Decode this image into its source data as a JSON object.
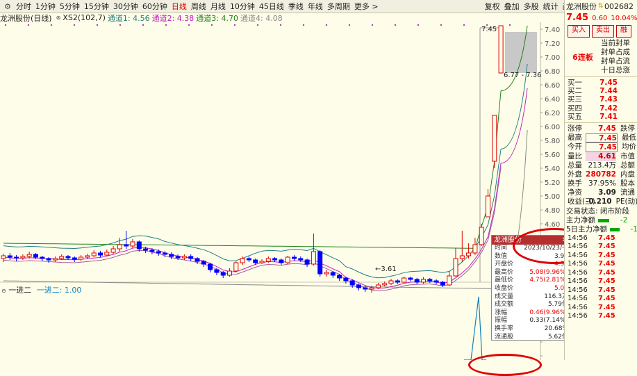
{
  "toolbar": {
    "items": [
      "分时",
      "1分钟",
      "5分钟",
      "15分钟",
      "30分钟",
      "60分钟",
      "日线",
      "周线",
      "月线",
      "10分钟",
      "45日线",
      "季线",
      "年线",
      "多周期",
      "更多 >"
    ],
    "active_index": 6,
    "right_items": [
      "复权",
      "叠加",
      "多股",
      "统计",
      "画线",
      "F10",
      "标记",
      "返回"
    ]
  },
  "legend": {
    "title": "龙洲股份(日线)",
    "xs2": "XS2(102,7)",
    "channel1": "通道1: 4.56",
    "channel2": "通道2: 4.38",
    "channel3": "通道3: 4.70",
    "channel4": "通道4: 4.08",
    "colors": {
      "ch1": "#208080",
      "ch2": "#c020c0",
      "ch3": "#208020",
      "ch4": "#888888"
    }
  },
  "sub_legend": {
    "name": "一进二",
    "value_label": "一进二: 1.00"
  },
  "chart_data": {
    "type": "candlestick",
    "title": "龙洲股份(日线)",
    "y_ticks": [
      "7.40",
      "7.20",
      "7.00",
      "6.80",
      "6.60",
      "6.40",
      "6.20",
      "6.00",
      "5.80",
      "5.60",
      "5.40",
      "5.20",
      "5.00",
      "4.80",
      "4.60",
      "4.40",
      "4.20",
      "4.00",
      "3.80",
      "3.60",
      "3.40",
      "3.20"
    ],
    "ylim": [
      3.2,
      7.45
    ],
    "annotations": {
      "high": "7.45",
      "low": "3.61",
      "band": "6.77 - 7.36"
    },
    "candles": [
      {
        "o": 4.1,
        "c": 4.14,
        "h": 4.17,
        "l": 4.05
      },
      {
        "o": 4.14,
        "c": 4.12,
        "h": 4.18,
        "l": 4.08
      },
      {
        "o": 4.12,
        "c": 4.11,
        "h": 4.15,
        "l": 4.06
      },
      {
        "o": 4.11,
        "c": 4.13,
        "h": 4.16,
        "l": 4.08
      },
      {
        "o": 4.13,
        "c": 4.16,
        "h": 4.2,
        "l": 4.1
      },
      {
        "o": 4.16,
        "c": 4.12,
        "h": 4.18,
        "l": 4.09
      },
      {
        "o": 4.12,
        "c": 4.1,
        "h": 4.14,
        "l": 4.06
      },
      {
        "o": 4.1,
        "c": 4.08,
        "h": 4.12,
        "l": 4.04
      },
      {
        "o": 4.08,
        "c": 4.1,
        "h": 4.13,
        "l": 4.05
      },
      {
        "o": 4.1,
        "c": 4.13,
        "h": 4.16,
        "l": 4.08
      },
      {
        "o": 4.13,
        "c": 4.11,
        "h": 4.15,
        "l": 4.08
      },
      {
        "o": 4.11,
        "c": 4.09,
        "h": 4.13,
        "l": 4.05
      },
      {
        "o": 4.09,
        "c": 4.12,
        "h": 4.15,
        "l": 4.06
      },
      {
        "o": 4.12,
        "c": 4.14,
        "h": 4.17,
        "l": 4.09
      },
      {
        "o": 4.14,
        "c": 4.18,
        "h": 4.22,
        "l": 4.12
      },
      {
        "o": 4.18,
        "c": 4.15,
        "h": 4.21,
        "l": 4.12
      },
      {
        "o": 4.15,
        "c": 4.19,
        "h": 4.23,
        "l": 4.13
      },
      {
        "o": 4.19,
        "c": 4.24,
        "h": 4.28,
        "l": 4.16
      },
      {
        "o": 4.24,
        "c": 4.3,
        "h": 4.4,
        "l": 4.2
      },
      {
        "o": 4.3,
        "c": 4.28,
        "h": 4.5,
        "l": 4.24
      },
      {
        "o": 4.28,
        "c": 4.34,
        "h": 4.38,
        "l": 4.25
      },
      {
        "o": 4.34,
        "c": 4.24,
        "h": 4.36,
        "l": 4.2
      },
      {
        "o": 4.24,
        "c": 4.22,
        "h": 4.27,
        "l": 4.18
      },
      {
        "o": 4.22,
        "c": 4.2,
        "h": 4.25,
        "l": 4.16
      },
      {
        "o": 4.2,
        "c": 4.18,
        "h": 4.23,
        "l": 4.14
      },
      {
        "o": 4.18,
        "c": 4.16,
        "h": 4.21,
        "l": 4.12
      },
      {
        "o": 4.16,
        "c": 4.13,
        "h": 4.19,
        "l": 4.09
      },
      {
        "o": 4.13,
        "c": 4.11,
        "h": 4.16,
        "l": 4.08
      },
      {
        "o": 4.11,
        "c": 4.13,
        "h": 4.16,
        "l": 4.08
      },
      {
        "o": 4.13,
        "c": 4.1,
        "h": 4.16,
        "l": 4.06
      },
      {
        "o": 4.1,
        "c": 4.06,
        "h": 4.12,
        "l": 4.02
      },
      {
        "o": 4.06,
        "c": 4.02,
        "h": 4.08,
        "l": 3.98
      },
      {
        "o": 4.02,
        "c": 3.94,
        "h": 4.04,
        "l": 3.9
      },
      {
        "o": 3.94,
        "c": 3.9,
        "h": 3.96,
        "l": 3.86
      },
      {
        "o": 3.9,
        "c": 3.86,
        "h": 3.92,
        "l": 3.82
      },
      {
        "o": 3.86,
        "c": 3.92,
        "h": 3.96,
        "l": 3.84
      },
      {
        "o": 3.92,
        "c": 4.04,
        "h": 4.06,
        "l": 3.9
      },
      {
        "o": 4.04,
        "c": 4.1,
        "h": 4.13,
        "l": 4.01
      },
      {
        "o": 4.1,
        "c": 4.08,
        "h": 4.13,
        "l": 4.05
      },
      {
        "o": 4.08,
        "c": 4.04,
        "h": 4.1,
        "l": 4.01
      },
      {
        "o": 4.04,
        "c": 4.06,
        "h": 4.09,
        "l": 4.02
      },
      {
        "o": 4.06,
        "c": 4.1,
        "h": 4.13,
        "l": 4.04
      },
      {
        "o": 4.1,
        "c": 4.08,
        "h": 4.12,
        "l": 4.05
      },
      {
        "o": 4.08,
        "c": 4.04,
        "h": 4.1,
        "l": 4.01
      },
      {
        "o": 4.04,
        "c": 4.12,
        "h": 4.14,
        "l": 4.02
      },
      {
        "o": 4.12,
        "c": 4.1,
        "h": 4.15,
        "l": 4.07
      },
      {
        "o": 4.1,
        "c": 4.08,
        "h": 4.13,
        "l": 4.05
      },
      {
        "o": 4.08,
        "c": 4.02,
        "h": 4.1,
        "l": 3.98
      },
      {
        "o": 4.02,
        "c": 4.2,
        "h": 4.46,
        "l": 4.0
      },
      {
        "o": 4.2,
        "c": 3.88,
        "h": 4.22,
        "l": 3.84
      },
      {
        "o": 3.88,
        "c": 3.9,
        "h": 3.94,
        "l": 3.84
      },
      {
        "o": 3.9,
        "c": 3.86,
        "h": 3.92,
        "l": 3.82
      },
      {
        "o": 3.86,
        "c": 3.82,
        "h": 3.88,
        "l": 3.78
      },
      {
        "o": 3.82,
        "c": 3.78,
        "h": 3.84,
        "l": 3.74
      },
      {
        "o": 3.78,
        "c": 3.72,
        "h": 3.8,
        "l": 3.68
      },
      {
        "o": 3.72,
        "c": 3.68,
        "h": 3.74,
        "l": 3.64
      },
      {
        "o": 3.68,
        "c": 3.66,
        "h": 3.71,
        "l": 3.62
      },
      {
        "o": 3.66,
        "c": 3.68,
        "h": 3.71,
        "l": 3.61
      },
      {
        "o": 3.68,
        "c": 3.72,
        "h": 3.75,
        "l": 3.66
      },
      {
        "o": 3.72,
        "c": 3.74,
        "h": 3.77,
        "l": 3.7
      },
      {
        "o": 3.74,
        "c": 3.78,
        "h": 3.81,
        "l": 3.72
      },
      {
        "o": 3.78,
        "c": 3.76,
        "h": 3.8,
        "l": 3.73
      },
      {
        "o": 3.76,
        "c": 3.82,
        "h": 3.84,
        "l": 3.74
      },
      {
        "o": 3.82,
        "c": 3.8,
        "h": 3.84,
        "l": 3.77
      },
      {
        "o": 3.8,
        "c": 3.76,
        "h": 3.82,
        "l": 3.73
      },
      {
        "o": 3.76,
        "c": 3.8,
        "h": 3.83,
        "l": 3.74
      },
      {
        "o": 3.8,
        "c": 3.78,
        "h": 3.82,
        "l": 3.75
      },
      {
        "o": 3.78,
        "c": 3.76,
        "h": 3.8,
        "l": 3.73
      },
      {
        "o": 3.76,
        "c": 3.72,
        "h": 3.78,
        "l": 3.69
      },
      {
        "o": 3.72,
        "c": 3.85,
        "h": 3.92,
        "l": 3.7
      },
      {
        "o": 3.85,
        "c": 4.1,
        "h": 4.25,
        "l": 3.84
      },
      {
        "o": 4.1,
        "c": 4.14,
        "h": 4.5,
        "l": 4.05
      },
      {
        "o": 4.14,
        "c": 4.18,
        "h": 4.32,
        "l": 4.1
      },
      {
        "o": 4.18,
        "c": 4.3,
        "h": 4.4,
        "l": 4.15
      },
      {
        "o": 4.3,
        "c": 4.55,
        "h": 4.6,
        "l": 4.28
      },
      {
        "o": 4.7,
        "c": 5.0,
        "h": 5.1,
        "l": 4.7
      },
      {
        "o": 5.5,
        "c": 6.16,
        "h": 6.16,
        "l": 5.4
      },
      {
        "o": 6.77,
        "c": 7.45,
        "h": 7.45,
        "l": 6.77
      }
    ]
  },
  "popup": {
    "title": "龙洲股份",
    "rows": [
      {
        "k": "时间",
        "v": "2023/10/23/一",
        "cls": "date"
      },
      {
        "k": "数值",
        "v": "3.90",
        "cls": ""
      },
      {
        "k": "开盘价",
        "v": "4.34",
        "cls": "red"
      },
      {
        "k": "最高价",
        "v": "5.08(9.96%)",
        "cls": "red"
      },
      {
        "k": "最低价",
        "v": "4.75(2.81%)",
        "cls": "red"
      },
      {
        "k": "收盘价",
        "v": "5.08",
        "cls": "red"
      },
      {
        "k": "成交量",
        "v": "116.3万",
        "cls": ""
      },
      {
        "k": "成交额",
        "v": "5.79亿",
        "cls": ""
      },
      {
        "k": "涨幅",
        "v": "0.46(9.96%)",
        "cls": "red"
      },
      {
        "k": "振幅",
        "v": "0.33(7.14%)",
        "cls": ""
      },
      {
        "k": "换手率",
        "v": "20.68%",
        "cls": ""
      },
      {
        "k": "流通股",
        "v": "5.62亿",
        "cls": ""
      }
    ]
  },
  "panel": {
    "name": "龙洲股份",
    "code": "002682",
    "price": "7.45",
    "change": "0.60",
    "pct": "10.04%",
    "buy": "买入",
    "sell": "卖出",
    "extra": "融",
    "tag": "6连板",
    "info": [
      "当前封单",
      "封单占成",
      "封单占流",
      "十日总涨"
    ],
    "book": [
      {
        "k": "买一",
        "v": "7.45"
      },
      {
        "k": "买二",
        "v": "7.44"
      },
      {
        "k": "买三",
        "v": "7.43"
      },
      {
        "k": "买四",
        "v": "7.42"
      },
      {
        "k": "买五",
        "v": "7.41"
      }
    ],
    "stats": [
      {
        "k": "涨停",
        "v": "7.45",
        "cls": "red",
        "k2": "跌停"
      },
      {
        "k": "最高",
        "v": "7.45",
        "cls": "red box",
        "k2": "最低"
      },
      {
        "k": "今开",
        "v": "7.45",
        "cls": "red box",
        "k2": "均价"
      },
      {
        "k": "量比",
        "v": "4.61",
        "cls": "pink",
        "k2": "市值"
      },
      {
        "k": "总量",
        "v": "213.4万",
        "cls": "",
        "k2": "总额"
      },
      {
        "k": "外盘",
        "v": "280782",
        "cls": "red",
        "k2": "内盘"
      },
      {
        "k": "换手",
        "v": "37.95%",
        "cls": "",
        "k2": "股本"
      },
      {
        "k": "净资",
        "v": "3.09",
        "cls": "bk",
        "k2": "流通"
      },
      {
        "k": "收益(三)",
        "v": "-0.210",
        "cls": "bk",
        "k2": "PE(动)"
      }
    ],
    "state": "交易状态: 闭市阶段",
    "flow1": "主力净额",
    "flow1_val": "-2",
    "flow2": "5日主力净额",
    "flow2_val": "-1",
    "trade_time": "14:56",
    "trade_price": "7.45"
  }
}
